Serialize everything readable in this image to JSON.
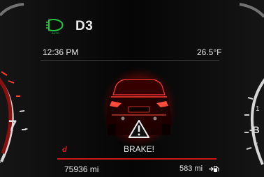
{
  "top_bar": {
    "headlight_icon": "auto-headlight-icon",
    "headlight_label": "AUTO",
    "gear": "D3"
  },
  "info": {
    "time": "12:36 PM",
    "temperature": "26.5°F"
  },
  "warning": {
    "car_image": "car-rear-view",
    "warning_icon": "warning-triangle-icon",
    "message": "BRAKE!",
    "indicator": "d"
  },
  "bottom": {
    "odometer": "75936 mi",
    "range": "583 mi",
    "fuel_icon": "fuel-pump-icon"
  },
  "gauges": {
    "left_number": "7",
    "left_dash": "-",
    "left_edge_mark": "/",
    "right_small": "1",
    "right_letter": "-B",
    "right_edge_mark": "/"
  },
  "colors": {
    "background": "#050505",
    "text": "#e8e8e8",
    "warning_red": "#d31b1b",
    "headlight_green": "#25c53f"
  }
}
